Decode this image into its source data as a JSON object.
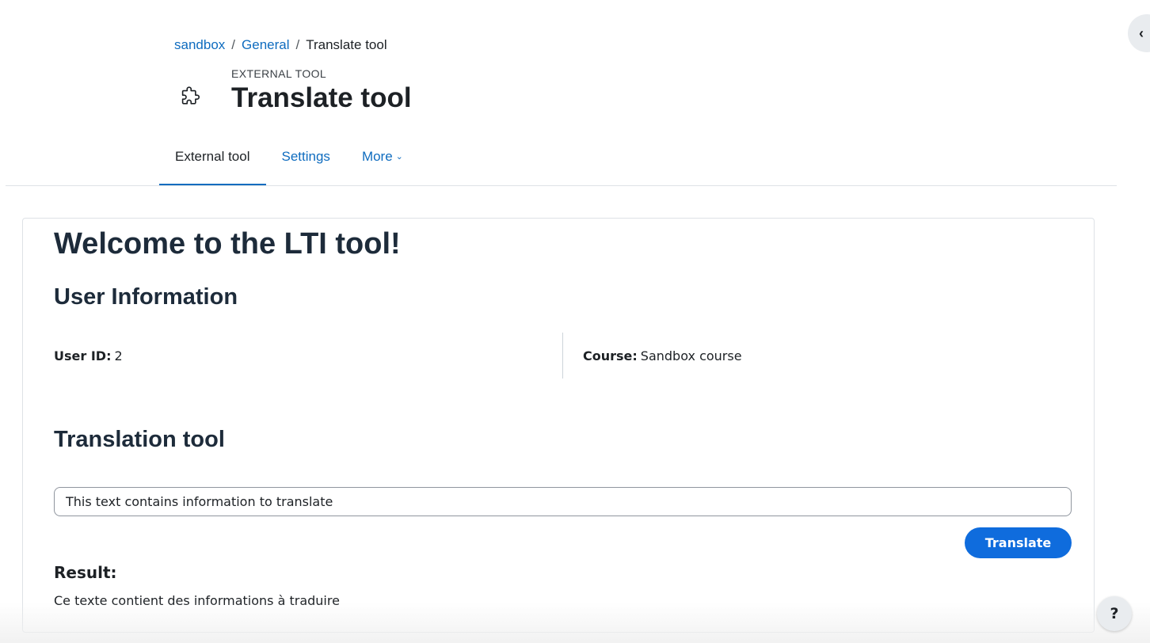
{
  "breadcrumb": {
    "items": [
      {
        "label": "sandbox",
        "link": true
      },
      {
        "label": "General",
        "link": true
      },
      {
        "label": "Translate tool",
        "link": false
      }
    ],
    "separator": "/"
  },
  "header": {
    "icon": "puzzle-piece-icon",
    "subtitle": "EXTERNAL TOOL",
    "title": "Translate tool"
  },
  "nav": {
    "tabs": [
      {
        "label": "External tool",
        "active": true
      },
      {
        "label": "Settings",
        "active": false
      },
      {
        "label": "More",
        "active": false,
        "dropdown": true
      }
    ],
    "more_chevron": "⌄"
  },
  "content": {
    "welcome": "Welcome to the LTI tool!",
    "user_info_heading": "User Information",
    "user_id_label": "User ID:",
    "user_id_value": "2",
    "course_label": "Course:",
    "course_value": "Sandbox course",
    "translation_heading": "Translation tool",
    "input_value": "This text contains information to translate",
    "translate_label": "Translate",
    "result_label": "Result:",
    "result_text": "Ce texte contient des informations à traduire"
  },
  "drawer_toggle": {
    "icon": "chevron-left-icon",
    "glyph": "‹"
  },
  "help": {
    "label": "?",
    "icon": "help-icon"
  },
  "colors": {
    "link": "#0f6cbf",
    "primary_button": "#0f6cdd",
    "heading": "#1d2b3a"
  }
}
